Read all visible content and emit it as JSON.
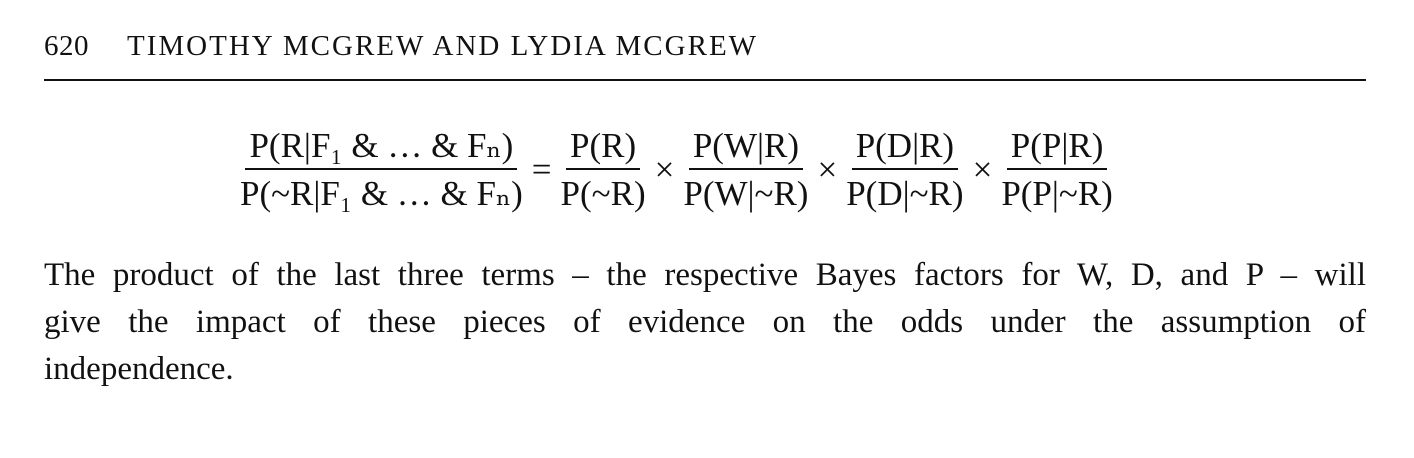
{
  "header": {
    "page_number": "620",
    "authors": "TIMOTHY MCGREW AND LYDIA MCGREW"
  },
  "equation": {
    "lhs": {
      "numerator": "P(R|F₁ & … & Fₙ)",
      "denominator": "P(~R|F₁ & … & Fₙ)"
    },
    "equals": "=",
    "times": "×",
    "terms": [
      {
        "numerator": "P(R)",
        "denominator": "P(~R)"
      },
      {
        "numerator": "P(W|R)",
        "denominator": "P(W|~R)"
      },
      {
        "numerator": "P(D|R)",
        "denominator": "P(D|~R)"
      },
      {
        "numerator": "P(P|R)",
        "denominator": "P(P|~R)"
      }
    ]
  },
  "body": {
    "lines": [
      "The product of the last three terms – the respective Bayes factors for W, D, and P – will",
      "give the impact of these pieces of evidence on the odds under the assumption of",
      "independence."
    ]
  }
}
